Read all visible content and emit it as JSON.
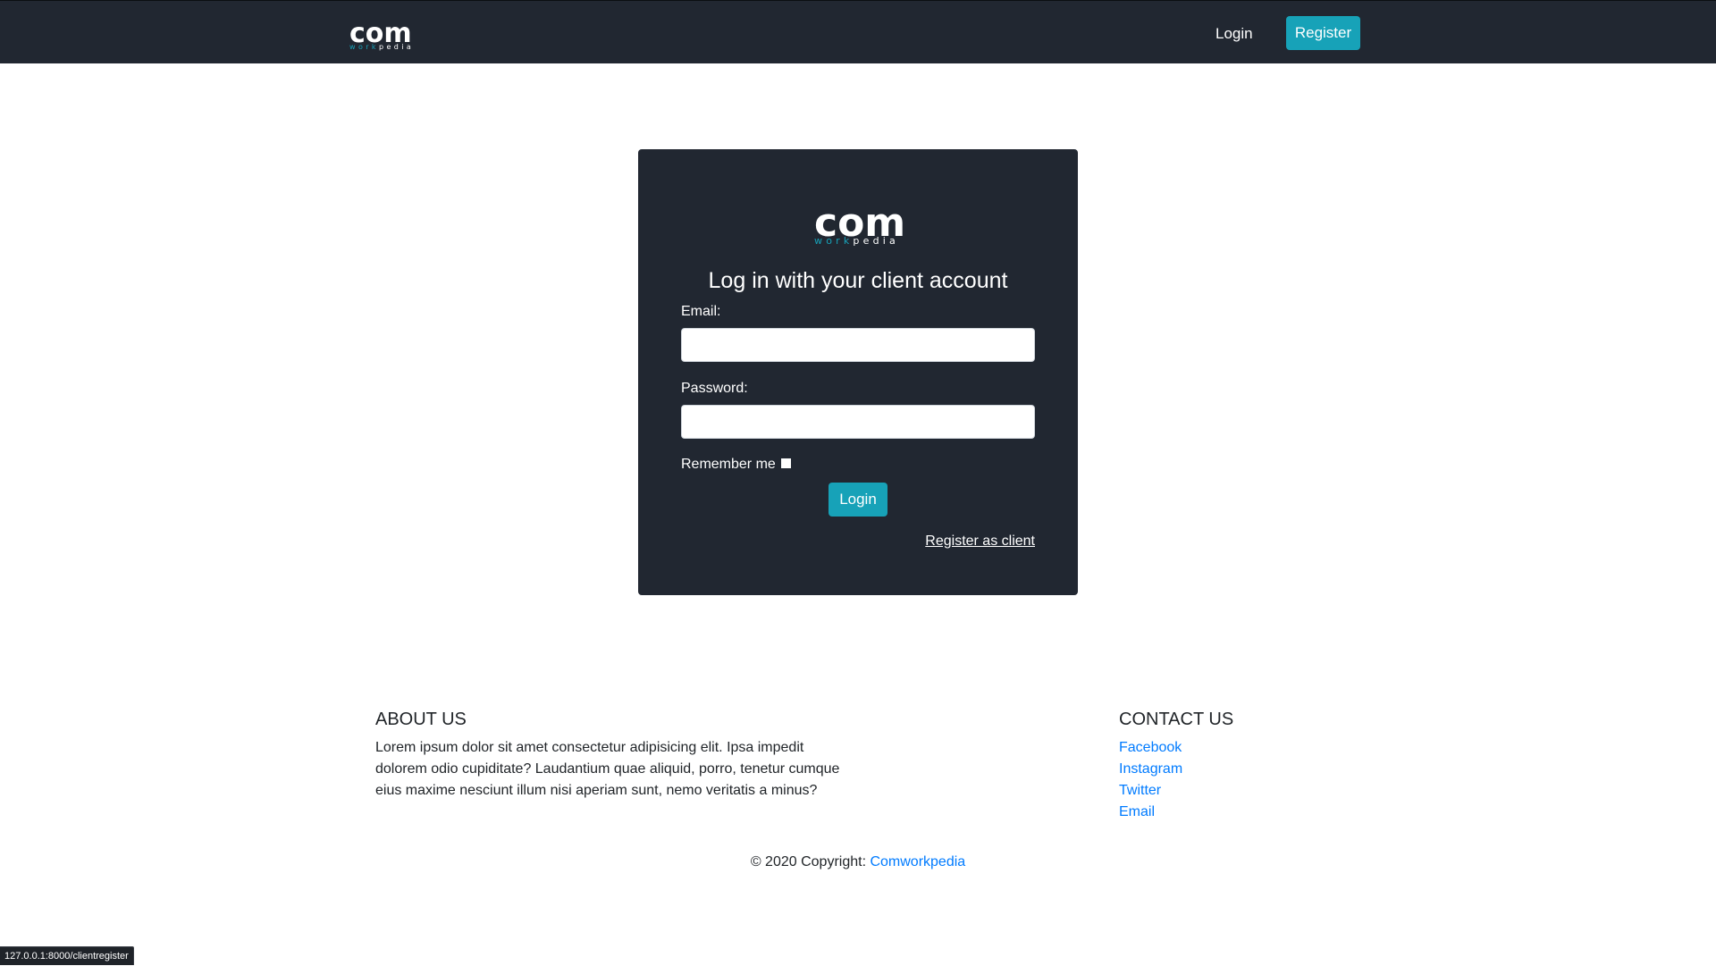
{
  "navbar": {
    "brand": {
      "main": "com",
      "sub_colored": "work",
      "sub_plain": "pedia"
    },
    "login_label": "Login",
    "register_label": "Register"
  },
  "card": {
    "logo": {
      "main": "com",
      "sub_colored": "work",
      "sub_plain": "pedia"
    },
    "title": "Log in with your client account",
    "email_label": "Email:",
    "email_value": "",
    "password_label": "Password:",
    "password_value": "",
    "remember_label": "Remember me",
    "remember_checked": false,
    "login_button": "Login",
    "register_link": "Register as client"
  },
  "footer": {
    "about": {
      "title": "ABOUT US",
      "text": "Lorem ipsum dolor sit amet consectetur adipisicing elit. Ipsa impedit dolorem odio cupiditate? Laudantium quae aliquid, porro, tenetur cumque eius maxime nesciunt illum nisi aperiam sunt, nemo veritatis a minus?"
    },
    "contact": {
      "title": "CONTACT US",
      "links": [
        "Facebook",
        "Instagram",
        "Twitter",
        "Email"
      ]
    },
    "copyright_prefix": "© 2020 Copyright:",
    "copyright_link": "Comworkpedia"
  },
  "status_bar": {
    "url": "127.0.0.1:8000/clientregister"
  },
  "colors": {
    "navbar_bg": "#212731",
    "accent": "#17a2b8",
    "link": "#007bff",
    "card_bg": "#212731"
  }
}
